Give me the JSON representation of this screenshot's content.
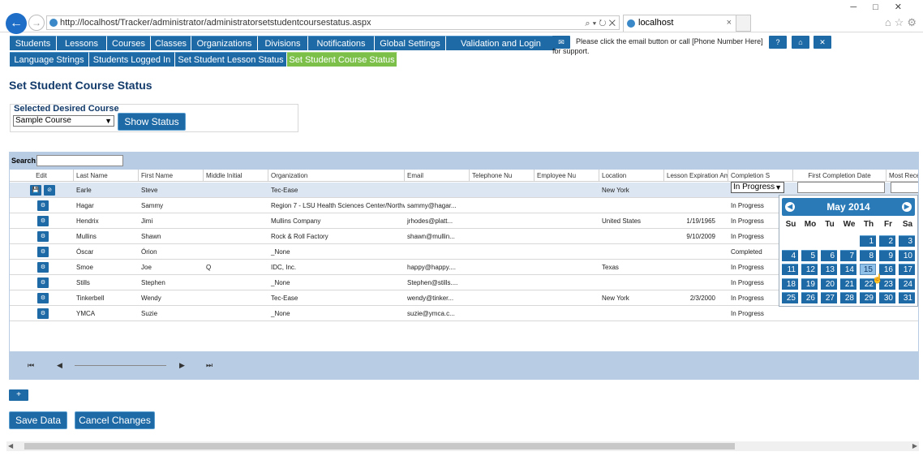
{
  "browser": {
    "url": "http://localhost/Tracker/administrator/administratorsetstudentcoursestatus.aspx",
    "tab_title": "localhost",
    "addr_tools": "⌕ ▾ ↻ ✕",
    "tab_close": "×"
  },
  "menu": {
    "row1": [
      "Students",
      "Lessons",
      "Courses",
      "Classes",
      "Organizations",
      "Divisions",
      "Notifications",
      "Global Settings",
      "Validation and Login Settings"
    ],
    "row2": [
      "Language Strings",
      "Students Logged In",
      "Set Student Lesson Status",
      "Set Student Course Status"
    ]
  },
  "support_text": "Please click the email button or call [Phone Number Here] for support.",
  "top_buttons": {
    "help": "?",
    "home": "⌂",
    "close": "✕",
    "email": "✉"
  },
  "page_title": "Set Student Course Status",
  "course": {
    "label": "Selected Desired Course",
    "selected": "Sample Course",
    "show_button": "Show Status"
  },
  "grid": {
    "search_label": "Search:",
    "columns": [
      "Edit",
      "Last Name",
      "First Name",
      "Middle Initial",
      "Organization",
      "Email",
      "Telephone Nu",
      "Employee Nu",
      "Location",
      "Lesson Expiration Am",
      "Completion S",
      "First Completion Date",
      "Most Rece"
    ],
    "rows": [
      {
        "last": "Earle",
        "first": "Steve",
        "mi": "",
        "org": "Tec-Ease",
        "email": "",
        "loc": "New York",
        "exp": "",
        "status": "In Progress"
      },
      {
        "last": "Hagar",
        "first": "Sammy",
        "mi": "",
        "org": "Region 7 - LSU Health Sciences Center/Northw...",
        "email": "sammy@hagar...",
        "loc": "",
        "exp": "",
        "status": "In Progress"
      },
      {
        "last": "Hendrix",
        "first": "Jimi",
        "mi": "",
        "org": "Mullins Company",
        "email": "jrhodes@platt...",
        "loc": "United States",
        "exp": "1/19/1965",
        "status": "In Progress"
      },
      {
        "last": "Mullins",
        "first": "Shawn",
        "mi": "",
        "org": "Rock & Roll Factory",
        "email": "shawn@mullin...",
        "loc": "",
        "exp": "9/10/2009",
        "status": "In Progress"
      },
      {
        "last": "Óscar",
        "first": "Órion",
        "mi": "",
        "org": "_None",
        "email": "",
        "loc": "",
        "exp": "",
        "status": "Completed"
      },
      {
        "last": "Smoe",
        "first": "Joe",
        "mi": "Q",
        "org": "IDC, Inc.",
        "email": "happy@happy....",
        "loc": "Texas",
        "exp": "",
        "status": "In Progress"
      },
      {
        "last": "Stills",
        "first": "Stephen",
        "mi": "",
        "org": "_None",
        "email": "Stephen@stills....",
        "loc": "",
        "exp": "",
        "status": "In Progress"
      },
      {
        "last": "Tinkerbell",
        "first": "Wendy",
        "mi": "",
        "org": "Tec-Ease",
        "email": "wendy@tinker...",
        "loc": "New York",
        "exp": "2/3/2000",
        "status": "In Progress"
      },
      {
        "last": "YMCA",
        "first": "Suzie",
        "mi": "",
        "org": "_None",
        "email": "suzie@ymca.c...",
        "loc": "",
        "exp": "",
        "status": "In Progress"
      }
    ],
    "edit_status_value": "In Progress",
    "row_icons": {
      "save": "💾",
      "cancel": "⊘",
      "edit": "⚙"
    },
    "pager_icons": {
      "first": "⏮",
      "prev": "◀",
      "next": "▶",
      "last": "⏭"
    }
  },
  "calendar": {
    "title": "May 2014",
    "dow": [
      "Su",
      "Mo",
      "Tu",
      "We",
      "Th",
      "Fr",
      "Sa"
    ],
    "first_weekday": 4,
    "days_in_month": 31,
    "highlighted_day": 15,
    "prev_icon": "◀",
    "next_icon": "▶"
  },
  "add_button": "+",
  "save_button": "Save Data",
  "cancel_button": "Cancel Changes",
  "colors": {
    "menu_blue": "#1e6aa6",
    "active_green": "#7cc04a",
    "grid_band": "#b8cce4"
  }
}
